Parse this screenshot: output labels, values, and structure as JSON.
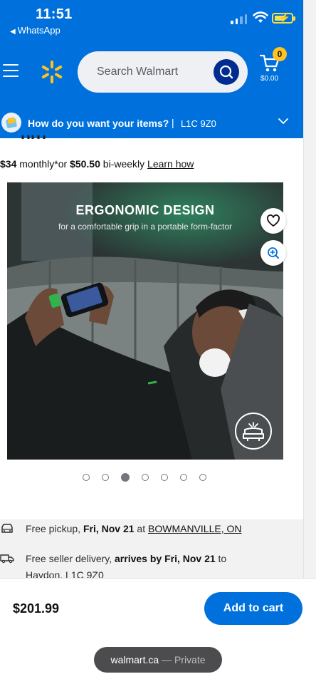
{
  "status_bar": {
    "time": "11:51",
    "back_app": "WhatsApp"
  },
  "header": {
    "search_placeholder": "Search Walmart",
    "cart_count": "0",
    "cart_total": "$0.00",
    "colors": {
      "brand_blue": "#0071dc",
      "spark_yellow": "#ffc220",
      "search_button": "#002d8f"
    }
  },
  "delivery_bar": {
    "question": "How do you want your items?",
    "separator": "|",
    "postal_code": "L1C 9Z0"
  },
  "financing": {
    "monthly_amount": "$34",
    "monthly_text": " monthly*or ",
    "biweekly_amount": "$50.50",
    "biweekly_text": " bi-weekly ",
    "learn_link": "Learn how"
  },
  "hero_image": {
    "title": "ERGONOMIC DESIGN",
    "subtitle": "for a comfortable grip in a portable form-factor",
    "carousel": {
      "total": 7,
      "active_index": 2
    }
  },
  "fulfillment": {
    "pickup": {
      "prefix": "Free pickup, ",
      "date": "Fri, Nov 21",
      "at": " at ",
      "store": "BOWMANVILLE, ON"
    },
    "delivery": {
      "prefix": "Free seller delivery, ",
      "arrives": "arrives by Fri, Nov 21",
      "to": " to",
      "location": "Haydon, L1C 9Z0"
    }
  },
  "footer": {
    "price": "$201.99",
    "add_to_cart": "Add to cart"
  },
  "browser_pill": {
    "domain": "walmart.ca",
    "dash": " — ",
    "mode": "Private"
  }
}
